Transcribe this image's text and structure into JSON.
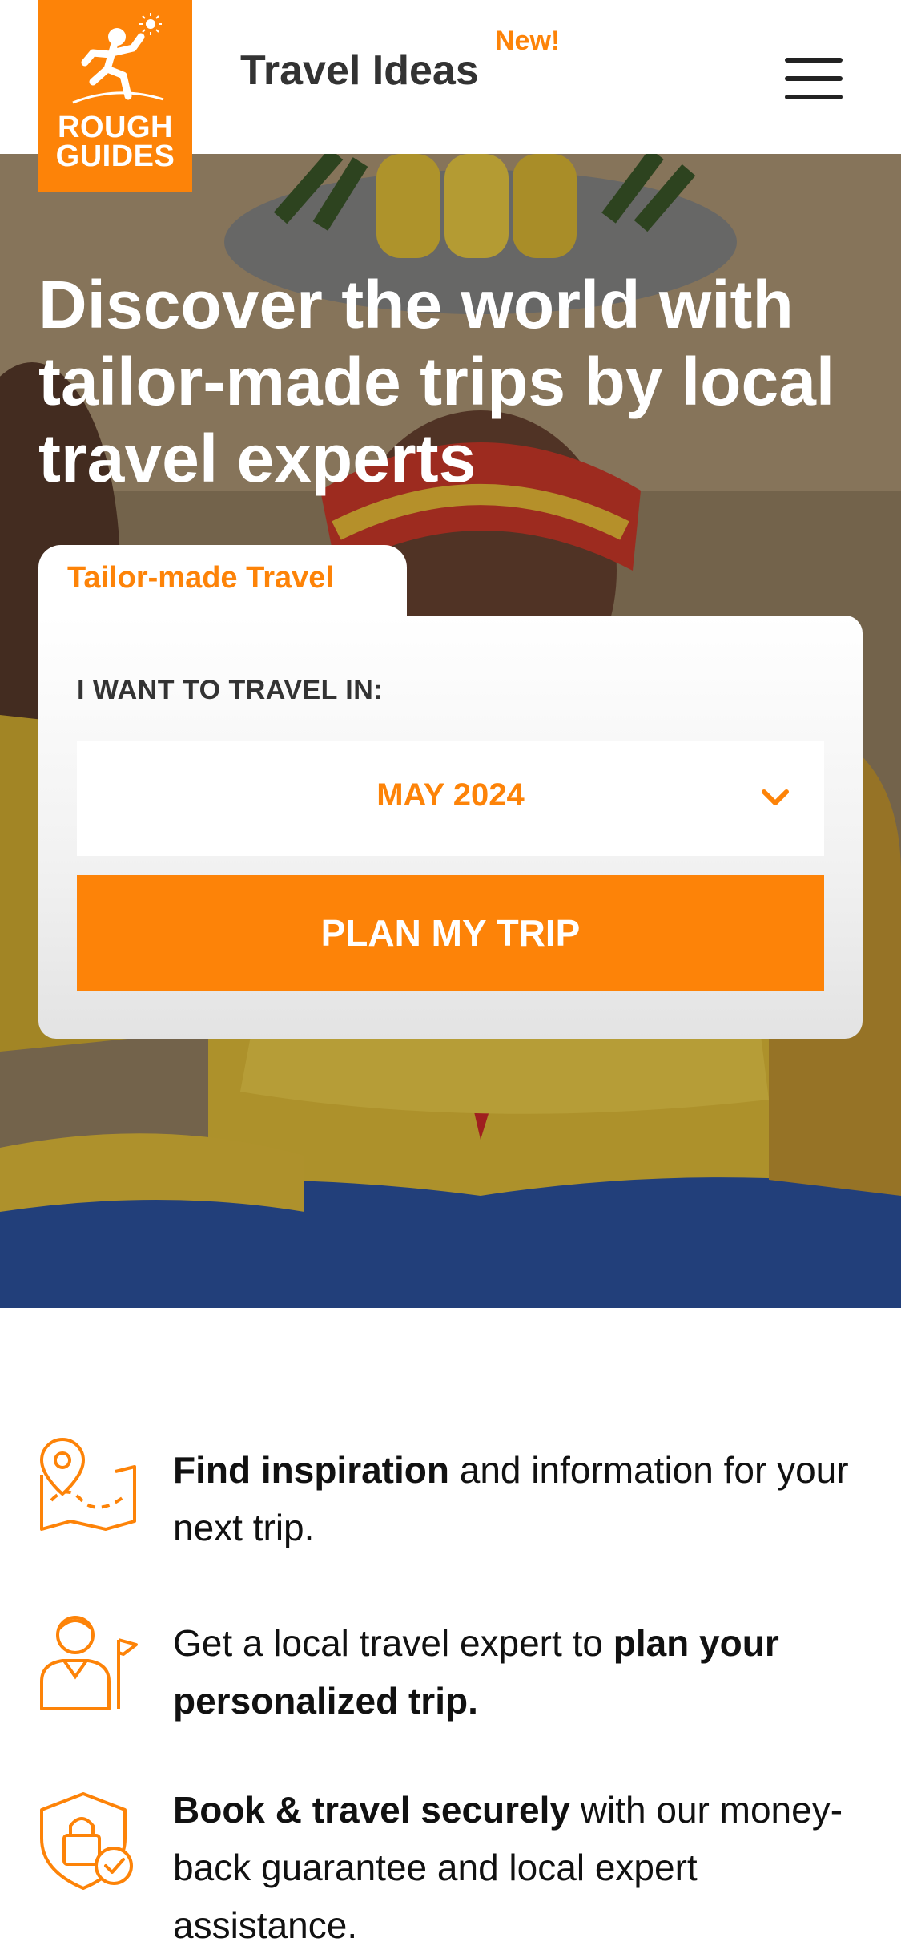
{
  "header": {
    "logo_line1": "ROUGH",
    "logo_line2": "GUIDES",
    "title": "Travel Ideas",
    "badge": "New!",
    "menu_icon": "hamburger-menu-icon"
  },
  "hero": {
    "headline": "Discover the world with tailor-made trips by local travel experts"
  },
  "booking": {
    "tab_label": "Tailor-made Travel",
    "field_label": "I WANT TO TRAVEL IN:",
    "selected_month": "MAY 2024",
    "cta_label": "PLAN MY TRIP"
  },
  "features": [
    {
      "icon": "map-pin-icon",
      "bold_a": "Find inspiration",
      "text_a": " and information for your next trip.",
      "bold_b": "",
      "text_b": ""
    },
    {
      "icon": "travel-expert-icon",
      "bold_a": "",
      "text_a": "Get a local travel expert to ",
      "bold_b": "plan your personalized trip.",
      "text_b": ""
    },
    {
      "icon": "secure-shield-icon",
      "bold_a": "Book & travel securely",
      "text_a": " with our money-back guarantee and local expert assistance.",
      "bold_b": "",
      "text_b": ""
    }
  ],
  "colors": {
    "accent": "#fd8308",
    "text": "#111111"
  }
}
